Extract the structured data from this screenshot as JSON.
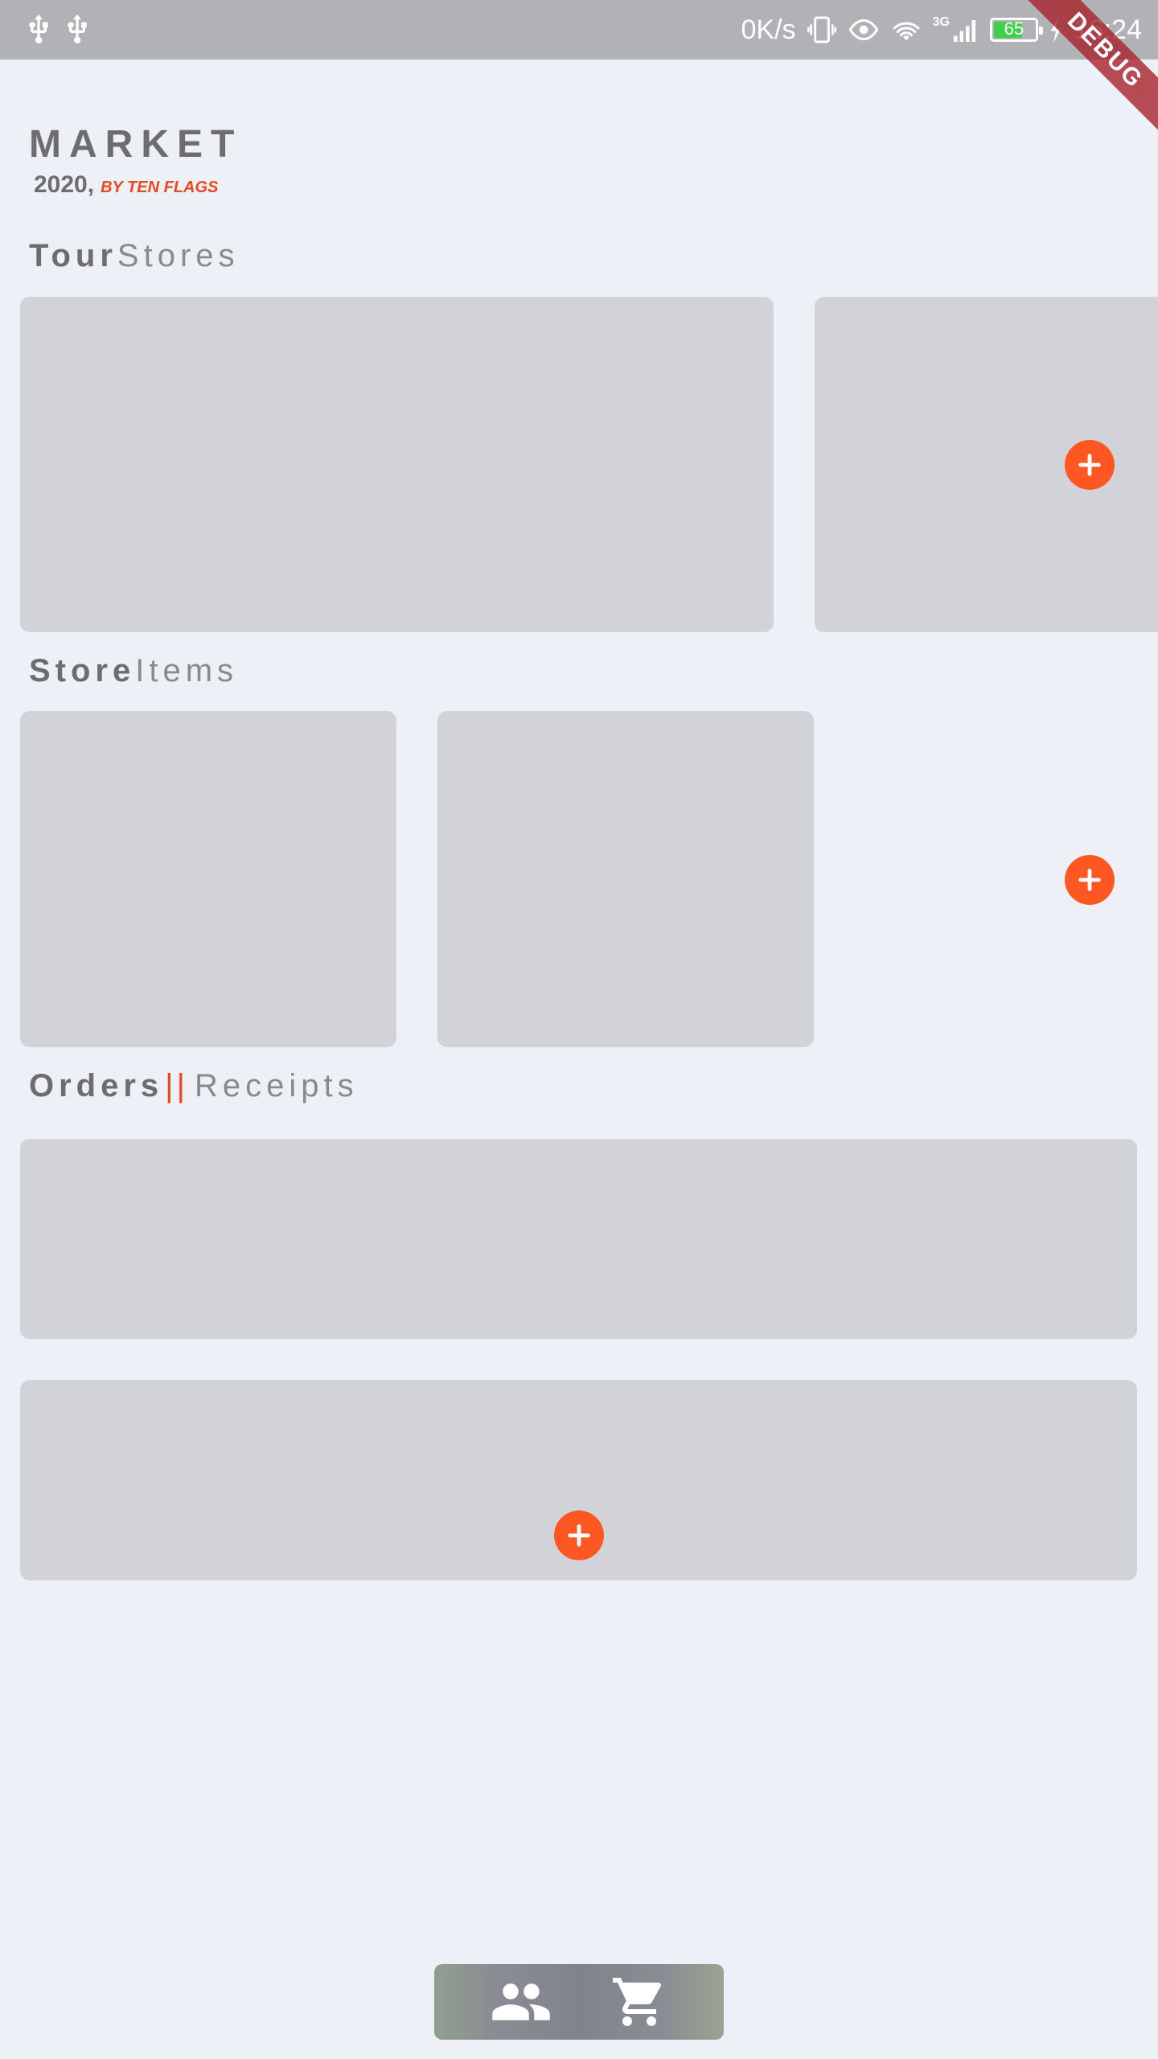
{
  "status_bar": {
    "network_speed": "0K/s",
    "network_type": "3G",
    "battery_level": "65",
    "battery_fraction": 0.65,
    "time": "16:24",
    "icons": [
      "usb-icon",
      "usb-icon",
      "vibrate-icon",
      "eye-comfort-icon",
      "wifi-icon",
      "signal-icon",
      "battery-icon",
      "charging-icon"
    ]
  },
  "debug_banner": "DEBUG",
  "header": {
    "title": "MARKET",
    "year": "2020,",
    "byline": "BY TEN FLAGS"
  },
  "sections": {
    "stores": {
      "strong": "Tour",
      "light": "Stores"
    },
    "items": {
      "strong": "Store",
      "light": "Items"
    },
    "orders": {
      "strong": "Orders",
      "separator": "||",
      "light": "Receipts"
    }
  },
  "bottom_nav": {
    "items": [
      "people-icon",
      "cart-icon"
    ]
  },
  "colors": {
    "background": "#edf0f7",
    "card": "#d1d3d8",
    "accent": "#fe5722",
    "byline": "#e8491d",
    "text": "#6d6d6d"
  }
}
